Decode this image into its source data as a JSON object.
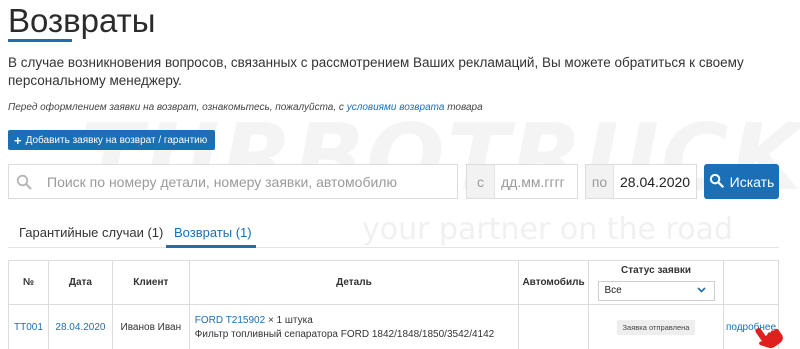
{
  "watermark": {
    "brand": "TURBOTRUCKS",
    "slogan": "your partner on the road"
  },
  "page": {
    "title": "Возвраты",
    "lead": "В случае возникновения вопросов, связанных с рассмотрением Ваших рекламаций, Вы можете обратиться к своему персональному менеджеру.",
    "note_before": "Перед оформлением заявки на возврат, ознакомьтесь, пожалуйста, с ",
    "note_link": "условиями возврата",
    "note_after": " товара"
  },
  "actions": {
    "add_label": "Добавить заявку на возврат / гарантию"
  },
  "search": {
    "placeholder": "Поиск по номеру детали, номеру заявки, автомобилю",
    "date_from_prefix": "с",
    "date_from_placeholder": "дд.мм.гггг",
    "date_to_prefix": "по",
    "date_to_value": "28.04.2020",
    "button_label": "Искать"
  },
  "tabs": [
    {
      "label": "Гарантийные случаи (1)",
      "active": false
    },
    {
      "label": "Возвраты (1)",
      "active": true
    }
  ],
  "table": {
    "headers": {
      "num": "№",
      "date": "Дата",
      "client": "Клиент",
      "detail": "Деталь",
      "car": "Автомобиль",
      "status": "Статус заявки"
    },
    "status_filter": "Все",
    "rows": [
      {
        "num": "TT001",
        "date": "28.04.2020",
        "client": "Иванов Иван",
        "part_link": "FORD T215902",
        "qty": " × 1 штука",
        "description": "Фильтр топливный сепаратора FORD 1842/1848/1850/3542/4142",
        "car": "",
        "status": "Заявка отправлена",
        "details_link": "подробнее"
      }
    ]
  },
  "colors": {
    "accent": "#1a6fb5",
    "cursor": "#e0201f"
  },
  "icons": [
    "plus-icon",
    "search-icon",
    "chevron-down-icon",
    "hand-pointer-icon"
  ]
}
